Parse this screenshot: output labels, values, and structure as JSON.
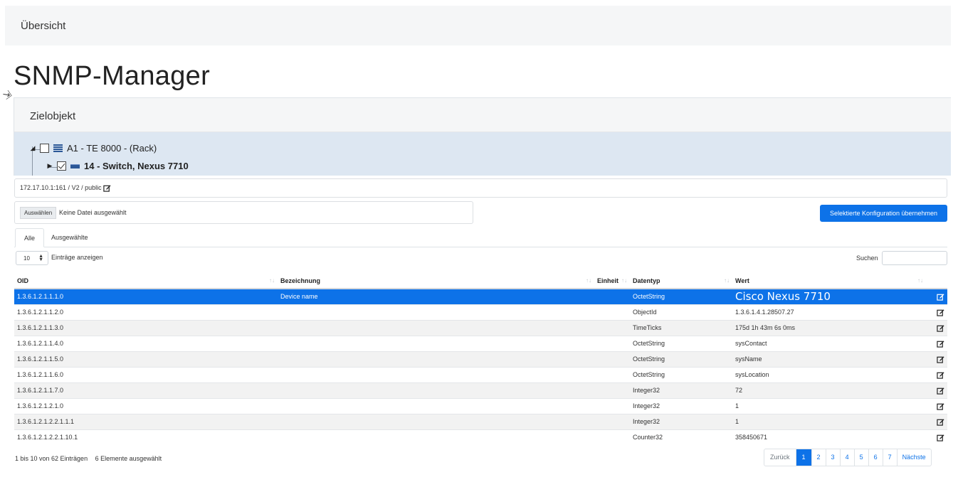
{
  "topbar": {
    "breadcrumb": "Übersicht"
  },
  "page_title": "SNMP-Manager",
  "target_panel": {
    "heading": "Zielobjekt",
    "tree": [
      {
        "label": "A1 - TE 8000 - (Rack)",
        "checked": false,
        "icon": "rack-icon"
      },
      {
        "label": "14 - Switch, Nexus 7710",
        "checked": true,
        "icon": "switch-icon"
      }
    ]
  },
  "connection": {
    "text": "172.17.10.1:161 / V2 / public"
  },
  "file_input": {
    "button": "Auswählen",
    "status": "Keine Datei ausgewählt"
  },
  "apply_button": "Selektierte Konfiguration übernehmen",
  "tabs": [
    {
      "label": "Alle",
      "active": true
    },
    {
      "label": "Ausgewählte",
      "active": false
    }
  ],
  "length_menu": {
    "value": "10",
    "label": "Einträge anzeigen"
  },
  "search": {
    "label": "Suchen",
    "value": ""
  },
  "table": {
    "columns": [
      "OID",
      "Bezeichnung",
      "Einheit",
      "Datentyp",
      "Wert"
    ],
    "rows": [
      {
        "oid": "1.3.6.1.2.1.1.1.0",
        "bezeichnung": "Device name",
        "einheit": "",
        "datentyp": "OctetString",
        "wert": "Cisco Nexus 7710",
        "selected": true
      },
      {
        "oid": "1.3.6.1.2.1.1.2.0",
        "bezeichnung": "",
        "einheit": "",
        "datentyp": "ObjectId",
        "wert": "1.3.6.1.4.1.28507.27"
      },
      {
        "oid": "1.3.6.1.2.1.1.3.0",
        "bezeichnung": "",
        "einheit": "",
        "datentyp": "TimeTicks",
        "wert": "175d 1h 43m 6s 0ms"
      },
      {
        "oid": "1.3.6.1.2.1.1.4.0",
        "bezeichnung": "",
        "einheit": "",
        "datentyp": "OctetString",
        "wert": "sysContact"
      },
      {
        "oid": "1.3.6.1.2.1.1.5.0",
        "bezeichnung": "",
        "einheit": "",
        "datentyp": "OctetString",
        "wert": "sysName"
      },
      {
        "oid": "1.3.6.1.2.1.1.6.0",
        "bezeichnung": "",
        "einheit": "",
        "datentyp": "OctetString",
        "wert": "sysLocation"
      },
      {
        "oid": "1.3.6.1.2.1.1.7.0",
        "bezeichnung": "",
        "einheit": "",
        "datentyp": "Integer32",
        "wert": "72"
      },
      {
        "oid": "1.3.6.1.2.1.2.1.0",
        "bezeichnung": "",
        "einheit": "",
        "datentyp": "Integer32",
        "wert": "1"
      },
      {
        "oid": "1.3.6.1.2.1.2.2.1.1.1",
        "bezeichnung": "",
        "einheit": "",
        "datentyp": "Integer32",
        "wert": "1"
      },
      {
        "oid": "1.3.6.1.2.1.2.2.1.10.1",
        "bezeichnung": "",
        "einheit": "",
        "datentyp": "Counter32",
        "wert": "358450671"
      }
    ]
  },
  "info": {
    "entries": "1 bis 10 von 62 Einträgen",
    "selected": "6 Elemente ausgewählt"
  },
  "pagination": {
    "prev": "Zurück",
    "pages": [
      "1",
      "2",
      "3",
      "4",
      "5",
      "6",
      "7"
    ],
    "current": "1",
    "next": "Nächste"
  },
  "colors": {
    "accent": "#0d72e8",
    "tree_bg": "#dde7f2",
    "header_bg": "#f5f6f7"
  }
}
